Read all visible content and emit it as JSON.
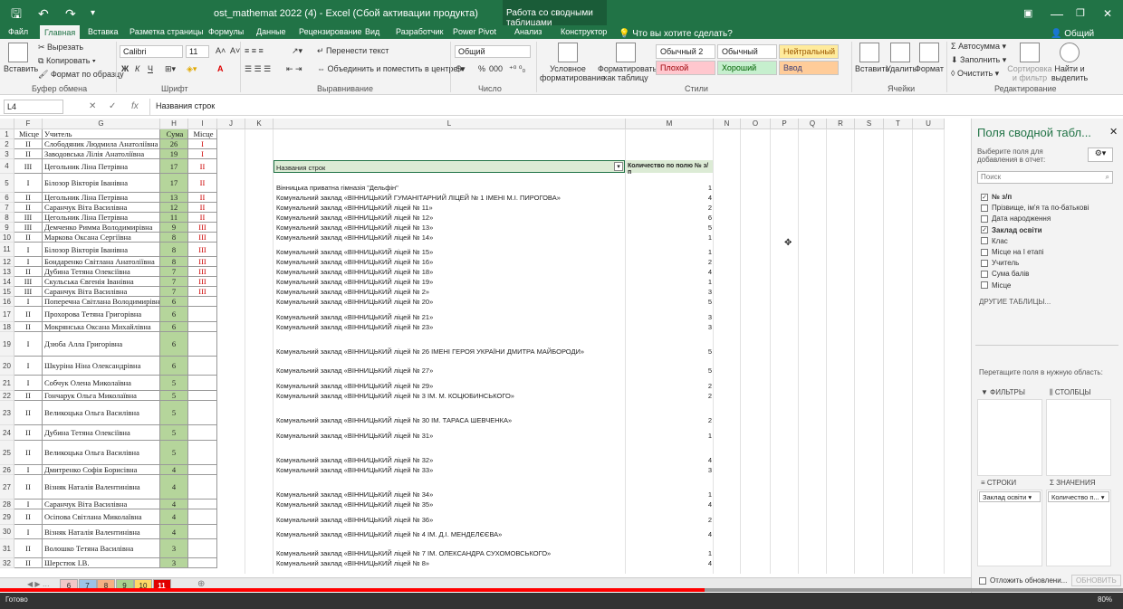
{
  "window": {
    "title": "ost_mathemat 2022 (4) - Excel (Сбой активации продукта)",
    "context_group": "Работа со сводными таблицами",
    "tell_me": "Что вы хотите сделать?",
    "share": "Общий доступ",
    "min": "—",
    "restore": "❐",
    "close": "✕"
  },
  "tabs": [
    "Файл",
    "Главная",
    "Вставка",
    "Разметка страницы",
    "Формулы",
    "Данные",
    "Рецензирование",
    "Вид",
    "Разработчик",
    "Power Pivot",
    "Анализ",
    "Конструктор"
  ],
  "ribbon": {
    "clipboard": {
      "paste": "Вставить",
      "cut": "Вырезать",
      "copy": "Копировать",
      "format_painter": "Формат по образцу",
      "label": "Буфер обмена"
    },
    "font": {
      "name": "Calibri",
      "size": "11",
      "label": "Шрифт",
      "bold": "Ж",
      "italic": "К",
      "underline": "Ч",
      "color_letter": "A"
    },
    "alignment": {
      "wrap": "Перенести текст",
      "merge": "Объединить и поместить в центре",
      "label": "Выравнивание"
    },
    "number": {
      "format": "Общий",
      "label": "Число",
      "percent": "%",
      "thousands": "000"
    },
    "styles": {
      "conditional": "Условное форматирование",
      "as_table": "Форматировать как таблицу",
      "cells": [
        "Обычный 2",
        "Обычный",
        "Нейтральный",
        "Плохой",
        "Хороший",
        "Ввод"
      ],
      "label": "Стили"
    },
    "cells": {
      "insert": "Вставить",
      "delete": "Удалить",
      "format": "Формат",
      "label": "Ячейки"
    },
    "editing": {
      "autosum": "Автосумма",
      "fill": "Заполнить",
      "clear": "Очистить",
      "sort": "Сортировка и фильтр",
      "find": "Найти и выделить",
      "label": "Редактирование"
    }
  },
  "formula_bar": {
    "name_box": "L4",
    "fx": "fx",
    "content": "Названия строк"
  },
  "columns": [
    "F",
    "G",
    "H",
    "I",
    "J",
    "K",
    "L",
    "M",
    "N",
    "O",
    "P",
    "Q",
    "R",
    "S",
    "T",
    "U"
  ],
  "table_header": {
    "place": "Місце",
    "teacher": "Учитель",
    "sum": "Сума",
    "place2": "Місце"
  },
  "rows": [
    {
      "n": "2",
      "p": "II",
      "t": "Слободяник Людмила Анатоліївна",
      "s": "26",
      "m": "I"
    },
    {
      "n": "3",
      "p": "II",
      "t": "Заводовська Лілія Анатоліївна",
      "s": "19",
      "m": "I"
    },
    {
      "n": "4",
      "p": "III",
      "t": "Цегольник Ліна Петрівна",
      "s": "17",
      "m": "II"
    },
    {
      "n": "5",
      "p": "I",
      "t": "Білозор Вікторія Іванівна",
      "s": "17",
      "m": "II"
    },
    {
      "n": "6",
      "p": "II",
      "t": "Цегольник Ліна Петрівна",
      "s": "13",
      "m": "II"
    },
    {
      "n": "7",
      "p": "II",
      "t": "Саранчук Віта Василівна",
      "s": "12",
      "m": "II"
    },
    {
      "n": "8",
      "p": "III",
      "t": "Цегольник Ліна Петрівна",
      "s": "11",
      "m": "II"
    },
    {
      "n": "9",
      "p": "III",
      "t": "Демченко Римма Володимирівна",
      "s": "9",
      "m": "III"
    },
    {
      "n": "10",
      "p": "II",
      "t": "Маркова Оксана Сергіївна",
      "s": "8",
      "m": "III"
    },
    {
      "n": "11",
      "p": "I",
      "t": "Білозор Вікторія Іванівна",
      "s": "8",
      "m": "III"
    },
    {
      "n": "12",
      "p": "I",
      "t": "Бондаренко Світлана Анатоліївна",
      "s": "8",
      "m": "III"
    },
    {
      "n": "13",
      "p": "II",
      "t": "Дубина Тетяна Олексіївна",
      "s": "7",
      "m": "III"
    },
    {
      "n": "14",
      "p": "III",
      "t": "Скульська Євгенія Іванівна",
      "s": "7",
      "m": "III"
    },
    {
      "n": "15",
      "p": "III",
      "t": "Саранчук Віта Василівна",
      "s": "7",
      "m": "III"
    },
    {
      "n": "16",
      "p": "I",
      "t": "Поперечна Світлана Володимирівна",
      "s": "6",
      "m": ""
    },
    {
      "n": "17",
      "p": "II",
      "t": "Прохорова Тетяна Григорівна",
      "s": "6",
      "m": ""
    },
    {
      "n": "18",
      "p": "II",
      "t": "Мокрянська Оксана Михайлівна",
      "s": "6",
      "m": ""
    },
    {
      "n": "19",
      "p": "I",
      "t": "Дзюба Алла Григорівна",
      "s": "6",
      "m": ""
    },
    {
      "n": "20",
      "p": "I",
      "t": "Шкуріна Ніна Олександрівна",
      "s": "6",
      "m": ""
    },
    {
      "n": "21",
      "p": "I",
      "t": "Собчук Олена Миколаївна",
      "s": "5",
      "m": ""
    },
    {
      "n": "22",
      "p": "II",
      "t": "Гончарук Ольга Миколаївна",
      "s": "5",
      "m": ""
    },
    {
      "n": "23",
      "p": "II",
      "t": "Великоцька Ольга Василівна",
      "s": "5",
      "m": ""
    },
    {
      "n": "24",
      "p": "II",
      "t": "Дубина Тетяна Олексіївна",
      "s": "5",
      "m": ""
    },
    {
      "n": "25",
      "p": "II",
      "t": "Великоцька Ольга Василівна",
      "s": "5",
      "m": ""
    },
    {
      "n": "26",
      "p": "I",
      "t": "Дмитренко Софія Борисівна",
      "s": "4",
      "m": ""
    },
    {
      "n": "27",
      "p": "II",
      "t": "Візняк Наталія Валентинівна",
      "s": "4",
      "m": ""
    },
    {
      "n": "28",
      "p": "I",
      "t": "Саранчук Віта Василівна",
      "s": "4",
      "m": ""
    },
    {
      "n": "29",
      "p": "II",
      "t": "Осіпова Світлана Миколаївна",
      "s": "4",
      "m": ""
    },
    {
      "n": "30",
      "p": "I",
      "t": "Візняк Наталія Валентинівна",
      "s": "4",
      "m": ""
    },
    {
      "n": "31",
      "p": "II",
      "t": "Волошко Тетяна Василівна",
      "s": "3",
      "m": ""
    },
    {
      "n": "32",
      "p": "II",
      "t": "Шерстюк І.В.",
      "s": "3",
      "m": ""
    }
  ],
  "pivot": {
    "header_rows": "Названия строк",
    "header_count": "Количество по полю № з/п",
    "items": [
      {
        "l": "Вінницька приватна гімназія \"Дельфін\"",
        "v": "1"
      },
      {
        "l": "Комунальний заклад «ВІННИЦЬКИЙ  ГУМАНІТАРНИЙ ЛІЦЕЙ № 1 ІМЕНІ М.І. ПИРОГОВА»",
        "v": "4"
      },
      {
        "l": "Комунальний заклад «ВІННИЦЬКИЙ  ліцей  № 11»",
        "v": "2"
      },
      {
        "l": "Комунальний заклад «ВІННИЦЬКИЙ  ліцей  № 12»",
        "v": "6"
      },
      {
        "l": "Комунальний заклад «ВІННИЦЬКИЙ  ліцей  № 13»",
        "v": "5"
      },
      {
        "l": "Комунальний заклад «ВІННИЦЬКИЙ  ліцей  № 14»",
        "v": "1"
      },
      {
        "l": "Комунальний заклад «ВІННИЦЬКИЙ  ліцей  № 15»",
        "v": "1"
      },
      {
        "l": "Комунальний заклад «ВІННИЦЬКИЙ  ліцей  № 16»",
        "v": "2"
      },
      {
        "l": "Комунальний заклад «ВІННИЦЬКИЙ  ліцей  № 18»",
        "v": "4"
      },
      {
        "l": "Комунальний заклад «ВІННИЦЬКИЙ  ліцей  № 19»",
        "v": "1"
      },
      {
        "l": "Комунальний заклад «ВІННИЦЬКИЙ  ліцей  № 2»",
        "v": "3"
      },
      {
        "l": "Комунальний заклад «ВІННИЦЬКИЙ  ліцей  № 20»",
        "v": "5"
      },
      {
        "l": "Комунальний заклад «ВІННИЦЬКИЙ  ліцей  № 21»",
        "v": "3"
      },
      {
        "l": "Комунальний заклад «ВІННИЦЬКИЙ  ліцей  № 23»",
        "v": "3"
      },
      {
        "l": "Комунальний заклад «ВІННИЦЬКИЙ  ліцей  № 26 ІМЕНІ ГЕРОЯ УКРАЇНИ ДМИТРА МАЙБОРОДИ»",
        "v": "5"
      },
      {
        "l": "Комунальний заклад «ВІННИЦЬКИЙ  ліцей  № 27»",
        "v": "5"
      },
      {
        "l": "Комунальний заклад «ВІННИЦЬКИЙ  ліцей  № 29»",
        "v": "2"
      },
      {
        "l": "Комунальний заклад «ВІННИЦЬКИЙ  ліцей  № 3 ІМ. М. КОЦЮБИНСЬКОГО»",
        "v": "2"
      },
      {
        "l": "Комунальний заклад «ВІННИЦЬКИЙ  ліцей  № 30  ІМ. ТАРАСА ШЕВЧЕНКА»",
        "v": "2"
      },
      {
        "l": "Комунальний заклад «ВІННИЦЬКИЙ  ліцей  № 31»",
        "v": "1"
      },
      {
        "l": "Комунальний заклад «ВІННИЦЬКИЙ  ліцей  № 32»",
        "v": "4"
      },
      {
        "l": "Комунальний заклад «ВІННИЦЬКИЙ  ліцей  № 33»",
        "v": "3"
      },
      {
        "l": "Комунальний заклад «ВІННИЦЬКИЙ  ліцей  № 34»",
        "v": "1"
      },
      {
        "l": "Комунальний заклад «ВІННИЦЬКИЙ  ліцей  № 35»",
        "v": "4"
      },
      {
        "l": "Комунальний заклад «ВІННИЦЬКИЙ  ліцей  № 36»",
        "v": "2"
      },
      {
        "l": "Комунальний заклад «ВІННИЦЬКИЙ  ліцей  № 4 ІМ. Д.І. МЕНДЕЛЄЄВА»",
        "v": "4"
      },
      {
        "l": "Комунальний заклад «ВІННИЦЬКИЙ  ліцей  № 7 ІМ. ОЛЕКСАНДРА СУХОМОВСЬКОГО»",
        "v": "1"
      },
      {
        "l": "Комунальний заклад «ВІННИЦЬКИЙ  ліцей  № 8»",
        "v": "4"
      }
    ]
  },
  "pane": {
    "title": "Поля сводной табл...",
    "subtitle": "Выберите поля для добавления в отчет:",
    "search": "Поиск",
    "fields": [
      {
        "name": "№ з/п",
        "checked": true
      },
      {
        "name": "Прізвище, ім'я та по-батькові",
        "checked": false
      },
      {
        "name": "Дата народження",
        "checked": false
      },
      {
        "name": "Заклад освіти",
        "checked": true
      },
      {
        "name": "Клас",
        "checked": false
      },
      {
        "name": "Місце на І етапі",
        "checked": false
      },
      {
        "name": "Учитель",
        "checked": false
      },
      {
        "name": "Сума балів",
        "checked": false
      },
      {
        "name": "Місце",
        "checked": false
      }
    ],
    "other": "ДРУГИЕ ТАБЛИЦЫ...",
    "drag": "Перетащите поля в нужную область:",
    "filters": "ФИЛЬТРЫ",
    "columns": "СТОЛБЦЫ",
    "rows": "СТРОКИ",
    "values": "ЗНАЧЕНИЯ",
    "rows_item": "Заклад освіти",
    "values_item": "Количество п...",
    "defer": "Отложить обновлени...",
    "update": "ОБНОВИТЬ"
  },
  "sheets": [
    {
      "name": "6",
      "color": "#f2c6c6"
    },
    {
      "name": "7",
      "color": "#9dc3e6"
    },
    {
      "name": "8",
      "color": "#f4b183"
    },
    {
      "name": "9",
      "color": "#a9d18e"
    },
    {
      "name": "10",
      "color": "#ffd966"
    },
    {
      "name": "11",
      "color": "#e00000"
    }
  ],
  "status": {
    "ready": "Готово",
    "zoom": "80%"
  }
}
